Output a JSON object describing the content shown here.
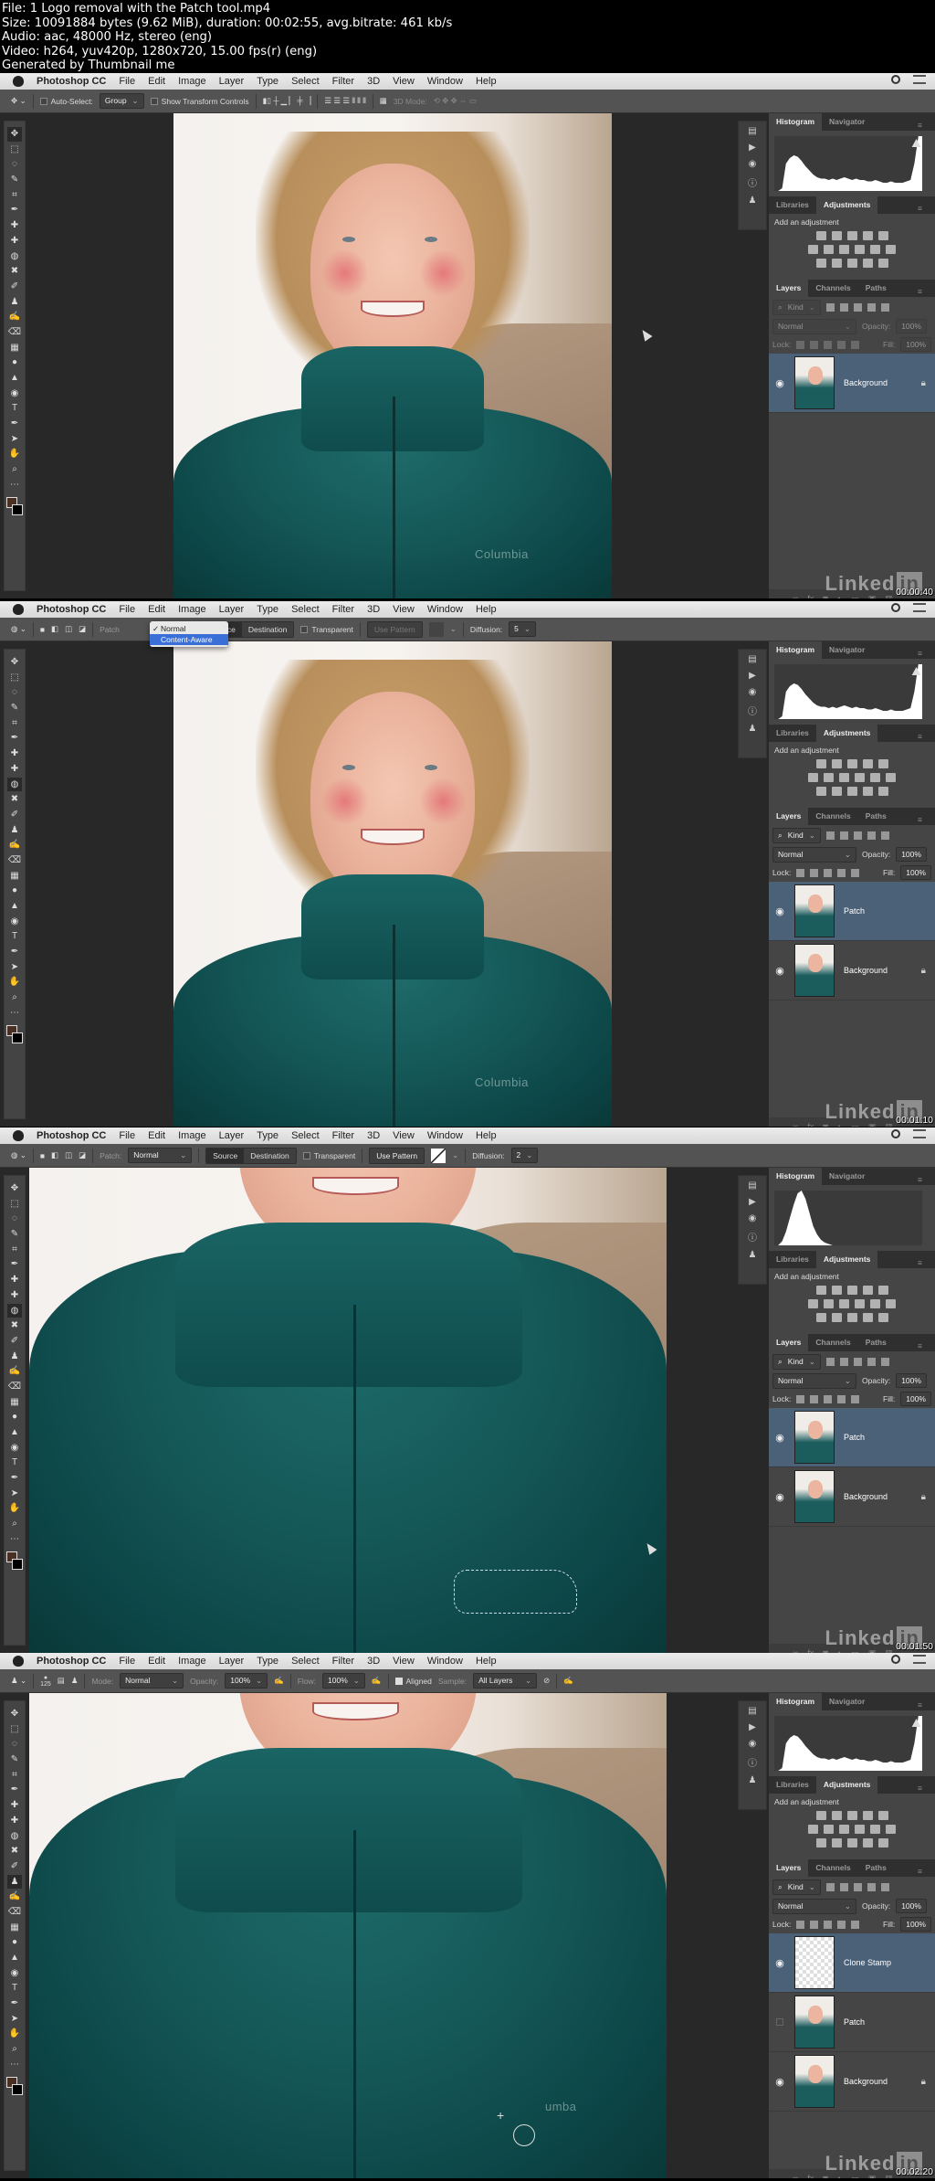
{
  "header": {
    "lines": [
      "File: 1 Logo removal with the Patch tool.mp4",
      "Size: 10091884 bytes (9.62 MiB), duration: 00:02:55, avg.bitrate: 461 kb/s",
      "Audio: aac, 48000 Hz, stereo (eng)",
      "Video: h264, yuv420p, 1280x720, 15.00 fps(r) (eng)",
      "Generated by Thumbnail me"
    ]
  },
  "menubar": {
    "app": "Photoshop CC",
    "items": [
      "File",
      "Edit",
      "Image",
      "Layer",
      "Type",
      "Select",
      "Filter",
      "3D",
      "View",
      "Window",
      "Help"
    ]
  },
  "panels": {
    "histogram_tab": "Histogram",
    "navigator_tab": "Navigator",
    "libraries_tab": "Libraries",
    "adjustments_tab": "Adjustments",
    "add_adjustment": "Add an adjustment",
    "layers_tab": "Layers",
    "channels_tab": "Channels",
    "paths_tab": "Paths",
    "kind": "Kind",
    "blend_mode": "Normal",
    "opacity_label": "Opacity:",
    "opacity_value": "100%",
    "lock_label": "Lock:",
    "fill_label": "Fill:",
    "fill_value": "100%",
    "footer_icons": [
      "link-icon",
      "fx-icon",
      "mask-icon",
      "adjustment-layer-icon",
      "group-icon",
      "new-layer-icon",
      "trash-icon"
    ]
  },
  "watermark": {
    "text": "Linked",
    "in": "in"
  },
  "jacket_logo": "Columbia",
  "frames": [
    {
      "timestamp": "00:00:40",
      "options": {
        "tool": "Move",
        "auto_select_label": "Auto-Select:",
        "auto_select_checked": false,
        "auto_select_value": "Group",
        "transform_label": "Show Transform Controls",
        "transform_checked": false,
        "mode3d_label": "3D Mode:"
      },
      "layers": [
        {
          "name": "Background",
          "visible": true,
          "selected": true,
          "locked": true,
          "transparent": false
        }
      ],
      "layers_disabled": true
    },
    {
      "timestamp": "00:01:10",
      "options": {
        "tool": "Patch",
        "patch_label": "Patch",
        "patch_dropdown": {
          "options": [
            "Normal",
            "Content-Aware"
          ],
          "checked": "Normal",
          "highlighted": "Content-Aware"
        },
        "source_label": "Source",
        "destination_label": "Destination",
        "transparent_label": "Transparent",
        "use_pattern_label": "Use Pattern",
        "use_pattern_enabled": false,
        "diffusion_label": "Diffusion:",
        "diffusion_value": "5"
      },
      "layers": [
        {
          "name": "Patch",
          "visible": true,
          "selected": true,
          "locked": false,
          "transparent": false
        },
        {
          "name": "Background",
          "visible": true,
          "selected": false,
          "locked": true,
          "transparent": false
        }
      ]
    },
    {
      "timestamp": "00:01:50",
      "options": {
        "tool": "Patch",
        "patch_label": "Patch:",
        "patch_value": "Normal",
        "source_label": "Source",
        "destination_label": "Destination",
        "transparent_label": "Transparent",
        "use_pattern_label": "Use Pattern",
        "use_pattern_enabled": true,
        "diffusion_label": "Diffusion:",
        "diffusion_value": "2"
      },
      "layers": [
        {
          "name": "Patch",
          "visible": true,
          "selected": true,
          "locked": false,
          "transparent": false
        },
        {
          "name": "Background",
          "visible": true,
          "selected": false,
          "locked": true,
          "transparent": false
        }
      ]
    },
    {
      "timestamp": "00:02:20",
      "options": {
        "tool": "Clone Stamp",
        "brush_size": "125",
        "mode_label": "Mode:",
        "mode_value": "Normal",
        "opacity_label": "Opacity:",
        "opacity_value": "100%",
        "flow_label": "Flow:",
        "flow_value": "100%",
        "aligned_label": "Aligned",
        "aligned_checked": true,
        "sample_label": "Sample:",
        "sample_value": "All Layers"
      },
      "layers": [
        {
          "name": "Clone Stamp",
          "visible": true,
          "selected": true,
          "locked": false,
          "transparent": true
        },
        {
          "name": "Patch",
          "visible": false,
          "selected": false,
          "locked": false,
          "transparent": false
        },
        {
          "name": "Background",
          "visible": true,
          "selected": false,
          "locked": true,
          "transparent": false
        }
      ]
    }
  ],
  "tools": [
    "move",
    "marquee",
    "lasso",
    "quick-select",
    "crop",
    "eyedropper",
    "spot-heal",
    "healing",
    "patch",
    "content-move",
    "brush",
    "clone-stamp",
    "history-brush",
    "eraser",
    "gradient",
    "blur",
    "sharpen",
    "dodge",
    "type",
    "pen",
    "path-select",
    "hand",
    "zoom",
    "more"
  ]
}
